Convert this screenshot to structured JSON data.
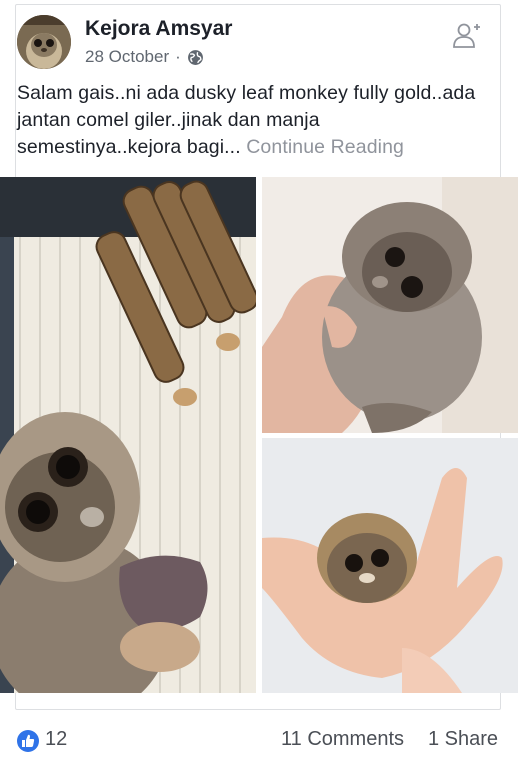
{
  "post": {
    "author": "Kejora Amsyar",
    "date": "28 October",
    "separator": "·",
    "privacy_icon": "globe-icon",
    "action_icon": "add-friend-icon",
    "text": "Salam gais..ni ada dusky leaf monkey fully gold..ada jantan comel giler..jinak dan manja semestinya..kejora bagi...",
    "continue_label": "Continue Reading"
  },
  "footer": {
    "reaction_icon": "thumbs-up-icon",
    "likes": "12",
    "comments": "11 Comments",
    "shares": "1 Share"
  },
  "colors": {
    "link_gray": "#90949c",
    "like_blue": "#2f73e8",
    "text": "#1d2129"
  }
}
